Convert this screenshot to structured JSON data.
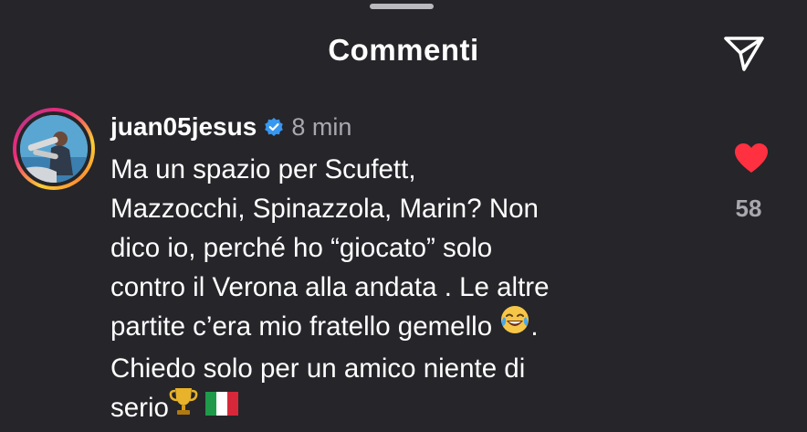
{
  "header": {
    "title": "Commenti"
  },
  "comment": {
    "username": "juan05jesus",
    "verified": true,
    "time": "8 min",
    "text_lines": [
      "Ma un spazio per Scufett,",
      "Mazzocchi, Spinazzola, Marin? Non",
      "dico io, perché ho “giocato” solo",
      "contro il Verona alla andata . Le altre",
      "partite c’era mio fratello gemello",
      "Chiedo solo per un amico niente di",
      "serio"
    ],
    "line5_suffix": ".",
    "emojis": {
      "laugh": "face-with-tears-of-joy-icon",
      "trophy": "trophy-icon",
      "flag": "italy-flag-icon"
    },
    "liked": true,
    "like_count": "58"
  },
  "colors": {
    "background": "#25252a",
    "text": "#ffffff",
    "secondary_text": "#a8a8ae",
    "heart": "#ff3040",
    "verified": "#3897f0"
  }
}
